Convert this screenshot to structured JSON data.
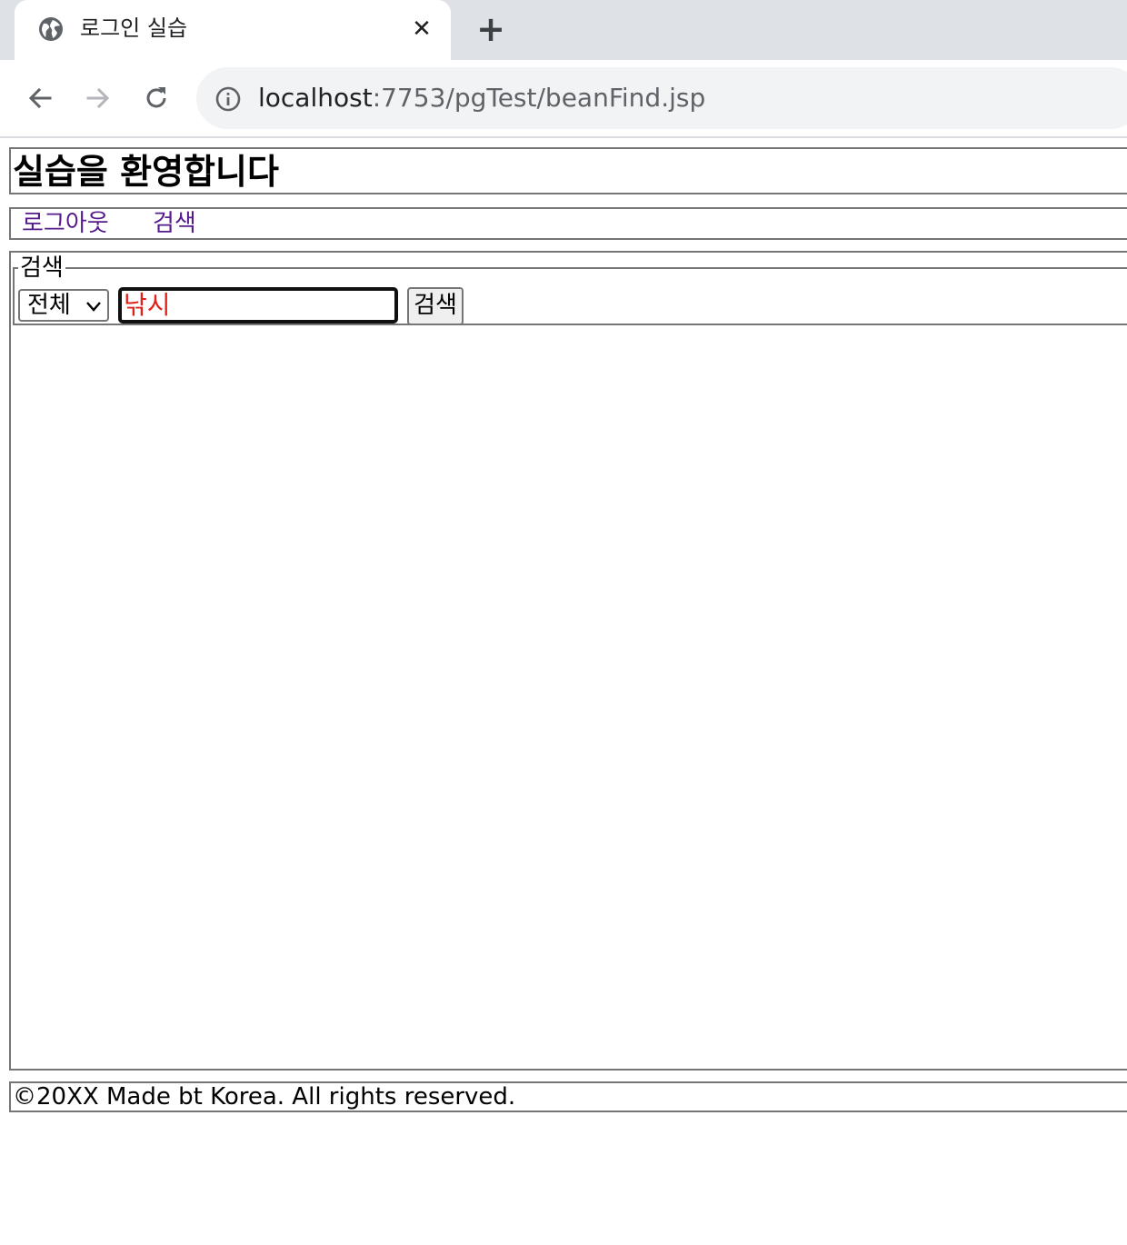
{
  "browser": {
    "tab_title": "로그인 실습",
    "tab_close_glyph": "✕",
    "new_tab_glyph": "+",
    "url_host": "localhost",
    "url_rest": ":7753/pgTest/beanFind.jsp",
    "icons": [
      "globe-icon",
      "close-icon",
      "plus-icon",
      "back-arrow-icon",
      "forward-arrow-icon",
      "reload-icon",
      "info-icon"
    ]
  },
  "header": {
    "title": "실습을 환영합니다"
  },
  "nav": {
    "links": [
      {
        "label": "로그아웃"
      },
      {
        "label": "검색"
      }
    ],
    "link_color": "#551a8b"
  },
  "search": {
    "legend": "검색",
    "select_value": "전체",
    "input_value": "낚시",
    "input_color": "#e0201b",
    "button_label": "검색"
  },
  "footer": {
    "text": "©20XX Made bt Korea. All rights reserved."
  }
}
